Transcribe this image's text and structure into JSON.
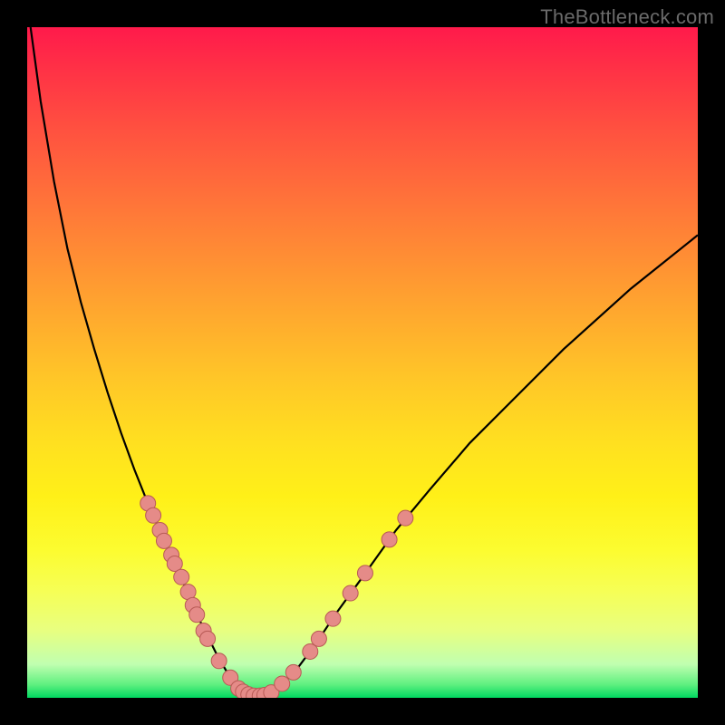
{
  "watermark": "TheBottleneck.com",
  "colors": {
    "background": "#000000",
    "gradient_top": "#ff1a4b",
    "gradient_bottom": "#00d860",
    "curve": "#000000",
    "dot_fill": "#e58b88",
    "dot_stroke": "#b85a55"
  },
  "chart_data": {
    "type": "line",
    "title": "",
    "xlabel": "",
    "ylabel": "",
    "xlim": [
      0,
      100
    ],
    "ylim": [
      0,
      100
    ],
    "grid": false,
    "series": [
      {
        "name": "bottleneck-curve",
        "x": [
          0.5,
          2,
          4,
          6,
          8,
          10,
          12,
          14,
          16,
          18,
          20,
          22,
          24,
          25.5,
          27,
          28.5,
          30,
          31,
          32,
          33,
          34.5,
          36,
          38,
          40,
          43,
          46,
          50,
          55,
          60,
          66,
          72,
          80,
          90,
          100
        ],
        "y": [
          100,
          89,
          77,
          67,
          59,
          52,
          45.5,
          39.5,
          34,
          29,
          24.5,
          20,
          15.5,
          12,
          9,
          6,
          3.5,
          2,
          1,
          0.4,
          0.2,
          0.6,
          2,
          4,
          8,
          12.5,
          18,
          25,
          31,
          38,
          44,
          52,
          61,
          69
        ]
      }
    ],
    "scatter": [
      {
        "name": "highlighted-points",
        "points": [
          {
            "x": 18.0,
            "y": 29.0
          },
          {
            "x": 18.8,
            "y": 27.2
          },
          {
            "x": 19.8,
            "y": 25.0
          },
          {
            "x": 20.4,
            "y": 23.4
          },
          {
            "x": 21.5,
            "y": 21.3
          },
          {
            "x": 22.0,
            "y": 20.0
          },
          {
            "x": 23.0,
            "y": 18.0
          },
          {
            "x": 24.0,
            "y": 15.8
          },
          {
            "x": 24.7,
            "y": 13.8
          },
          {
            "x": 25.3,
            "y": 12.4
          },
          {
            "x": 26.3,
            "y": 10.0
          },
          {
            "x": 26.9,
            "y": 8.8
          },
          {
            "x": 28.6,
            "y": 5.5
          },
          {
            "x": 30.3,
            "y": 3.0
          },
          {
            "x": 31.5,
            "y": 1.4
          },
          {
            "x": 32.2,
            "y": 0.9
          },
          {
            "x": 33.0,
            "y": 0.5
          },
          {
            "x": 33.8,
            "y": 0.3
          },
          {
            "x": 34.7,
            "y": 0.3
          },
          {
            "x": 35.4,
            "y": 0.4
          },
          {
            "x": 36.4,
            "y": 0.8
          },
          {
            "x": 38.0,
            "y": 2.1
          },
          {
            "x": 39.7,
            "y": 3.8
          },
          {
            "x": 42.2,
            "y": 6.9
          },
          {
            "x": 43.5,
            "y": 8.8
          },
          {
            "x": 45.6,
            "y": 11.8
          },
          {
            "x": 48.2,
            "y": 15.6
          },
          {
            "x": 50.4,
            "y": 18.6
          },
          {
            "x": 54.0,
            "y": 23.6
          },
          {
            "x": 56.4,
            "y": 26.8
          }
        ]
      }
    ]
  }
}
